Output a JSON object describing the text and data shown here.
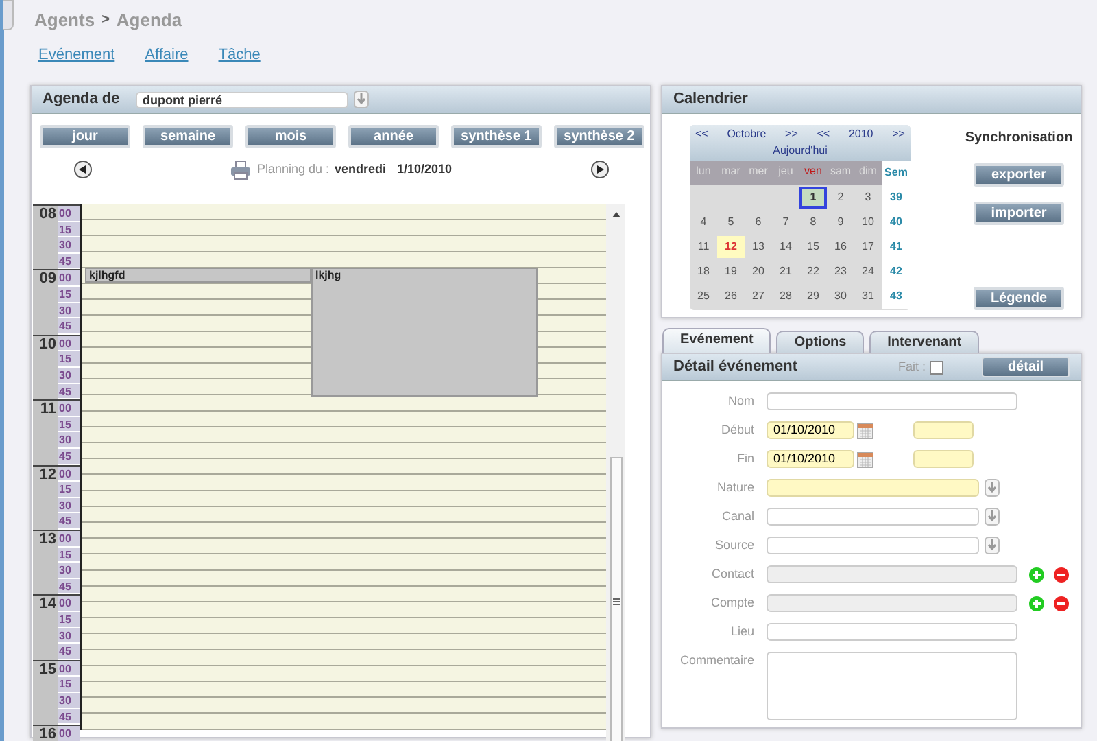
{
  "breadcrumb": [
    {
      "label": "Agents",
      "kind": "parent"
    },
    {
      "label": ">",
      "kind": "separator"
    },
    {
      "label": "Agenda",
      "kind": "current"
    }
  ],
  "links": [
    "Evénement",
    "Affaire",
    "Tâche"
  ],
  "agenda": {
    "title": "Agenda de",
    "owner": "dupont pierré",
    "views": [
      {
        "label": "jour"
      },
      {
        "label": "semaine"
      },
      {
        "label": "mois"
      },
      {
        "label": "année"
      },
      {
        "label": "synthèse 1"
      },
      {
        "label": "synthèse 2"
      }
    ],
    "planning_label": "Planning du :",
    "planning_day": "vendredi",
    "planning_date": "1/10/2010",
    "hours": [
      {
        "label": "08",
        "slots": [
          {
            "label": "00"
          },
          {
            "label": "15"
          },
          {
            "label": "30"
          },
          {
            "label": "45"
          }
        ]
      },
      {
        "label": "09",
        "slots": [
          {
            "label": "00",
            "cells": [
              {
                "kind": "event",
                "title": "kjlhgfd"
              },
              {
                "kind": "event",
                "title": "lkjhg"
              }
            ]
          },
          {
            "label": "15",
            "cells": [
              {
                "kind": "free"
              },
              {
                "kind": "continued"
              }
            ]
          },
          {
            "label": "30",
            "cells": [
              {
                "kind": "free"
              },
              {
                "kind": "continued"
              }
            ]
          },
          {
            "label": "45",
            "cells": [
              {
                "kind": "free"
              },
              {
                "kind": "continued"
              }
            ]
          }
        ]
      },
      {
        "label": "10",
        "slots": [
          {
            "label": "00",
            "cells": [
              {
                "kind": "free"
              },
              {
                "kind": "continued"
              }
            ]
          },
          {
            "label": "15",
            "cells": [
              {
                "kind": "free"
              },
              {
                "kind": "continued"
              }
            ]
          },
          {
            "label": "30",
            "cells": [
              {
                "kind": "free"
              },
              {
                "kind": "continued"
              }
            ]
          },
          {
            "label": "45",
            "cells": [
              {
                "kind": "free"
              },
              {
                "kind": "continued"
              }
            ]
          }
        ]
      },
      {
        "label": "11",
        "slots": [
          {
            "label": "00"
          },
          {
            "label": "15"
          },
          {
            "label": "30"
          },
          {
            "label": "45"
          }
        ]
      },
      {
        "label": "12",
        "slots": [
          {
            "label": "00"
          },
          {
            "label": "15"
          },
          {
            "label": "30"
          },
          {
            "label": "45"
          }
        ]
      },
      {
        "label": "13",
        "slots": [
          {
            "label": "00"
          },
          {
            "label": "15"
          },
          {
            "label": "30"
          },
          {
            "label": "45"
          }
        ]
      },
      {
        "label": "14",
        "slots": [
          {
            "label": "00"
          },
          {
            "label": "15"
          },
          {
            "label": "30"
          },
          {
            "label": "45"
          }
        ]
      },
      {
        "label": "15",
        "slots": [
          {
            "label": "00"
          },
          {
            "label": "15"
          },
          {
            "label": "30"
          },
          {
            "label": "45"
          }
        ]
      },
      {
        "label": "16",
        "slots": [
          {
            "label": "00"
          }
        ]
      }
    ]
  },
  "calendar": {
    "title": "Calendrier",
    "prev_month": "<<",
    "month": "Octobre",
    "next_month": ">>",
    "prev_year": "<<",
    "year": "2010",
    "next_year": ">>",
    "today_link": "Aujourd'hui",
    "weekdays": [
      {
        "label": "lun",
        "highlighted": false
      },
      {
        "label": "mar",
        "highlighted": false
      },
      {
        "label": "mer",
        "highlighted": false
      },
      {
        "label": "jeu",
        "highlighted": false
      },
      {
        "label": "ven",
        "highlighted": true
      },
      {
        "label": "sam",
        "highlighted": false
      },
      {
        "label": "dim",
        "highlighted": false
      }
    ],
    "week_header": "Sem",
    "weeks": [
      {
        "week": "39",
        "days": [
          {
            "kind": "blank"
          },
          {
            "kind": "blank"
          },
          {
            "kind": "blank"
          },
          {
            "kind": "blank"
          },
          {
            "kind": "day",
            "label": "1",
            "selected": true,
            "today": false
          },
          {
            "kind": "day",
            "label": "2",
            "selected": false,
            "today": false
          },
          {
            "kind": "day",
            "label": "3",
            "selected": false,
            "today": false
          }
        ]
      },
      {
        "week": "40",
        "days": [
          {
            "kind": "day",
            "label": "4",
            "selected": false,
            "today": false
          },
          {
            "kind": "day",
            "label": "5",
            "selected": false,
            "today": false
          },
          {
            "kind": "day",
            "label": "6",
            "selected": false,
            "today": false
          },
          {
            "kind": "day",
            "label": "7",
            "selected": false,
            "today": false
          },
          {
            "kind": "day",
            "label": "8",
            "selected": false,
            "today": false
          },
          {
            "kind": "day",
            "label": "9",
            "selected": false,
            "today": false
          },
          {
            "kind": "day",
            "label": "10",
            "selected": false,
            "today": false
          }
        ]
      },
      {
        "week": "41",
        "days": [
          {
            "kind": "day",
            "label": "11",
            "selected": false,
            "today": false
          },
          {
            "kind": "day",
            "label": "12",
            "selected": false,
            "today": true
          },
          {
            "kind": "day",
            "label": "13",
            "selected": false,
            "today": false
          },
          {
            "kind": "day",
            "label": "14",
            "selected": false,
            "today": false
          },
          {
            "kind": "day",
            "label": "15",
            "selected": false,
            "today": false
          },
          {
            "kind": "day",
            "label": "16",
            "selected": false,
            "today": false
          },
          {
            "kind": "day",
            "label": "17",
            "selected": false,
            "today": false
          }
        ]
      },
      {
        "week": "42",
        "days": [
          {
            "kind": "day",
            "label": "18",
            "selected": false,
            "today": false
          },
          {
            "kind": "day",
            "label": "19",
            "selected": false,
            "today": false
          },
          {
            "kind": "day",
            "label": "20",
            "selected": false,
            "today": false
          },
          {
            "kind": "day",
            "label": "21",
            "selected": false,
            "today": false
          },
          {
            "kind": "day",
            "label": "22",
            "selected": false,
            "today": false
          },
          {
            "kind": "day",
            "label": "23",
            "selected": false,
            "today": false
          },
          {
            "kind": "day",
            "label": "24",
            "selected": false,
            "today": false
          }
        ]
      },
      {
        "week": "43",
        "days": [
          {
            "kind": "day",
            "label": "25",
            "selected": false,
            "today": false
          },
          {
            "kind": "day",
            "label": "26",
            "selected": false,
            "today": false
          },
          {
            "kind": "day",
            "label": "27",
            "selected": false,
            "today": false
          },
          {
            "kind": "day",
            "label": "28",
            "selected": false,
            "today": false
          },
          {
            "kind": "day",
            "label": "29",
            "selected": false,
            "today": false
          },
          {
            "kind": "day",
            "label": "30",
            "selected": false,
            "today": false
          },
          {
            "kind": "day",
            "label": "31",
            "selected": false,
            "today": false
          }
        ]
      }
    ],
    "sync_title": "Synchronisation",
    "export_button": "exporter",
    "import_button": "importer",
    "legend_button": "Légende"
  },
  "tabs": [
    {
      "label": "Evénement",
      "selected": true
    },
    {
      "label": "Options",
      "selected": false
    },
    {
      "label": "Intervenant",
      "selected": false
    }
  ],
  "detail": {
    "title": "Détail événement",
    "done_label": "Fait :",
    "done": false,
    "detail_button": "détail",
    "fields": [
      {
        "label": "Nom",
        "kind": "text",
        "required": false
      },
      {
        "label": "Début",
        "kind": "datetime",
        "value": "01/10/2010",
        "required": true
      },
      {
        "label": "Fin",
        "kind": "datetime",
        "value": "01/10/2010",
        "required": true
      },
      {
        "label": "Nature",
        "kind": "select",
        "required": true
      },
      {
        "label": "Canal",
        "kind": "select",
        "required": false
      },
      {
        "label": "Source",
        "kind": "select",
        "required": false
      },
      {
        "label": "Contact",
        "kind": "lookup",
        "required": false
      },
      {
        "label": "Compte",
        "kind": "lookup",
        "required": false
      },
      {
        "label": "Lieu",
        "kind": "text",
        "required": false
      },
      {
        "label": "Commentaire",
        "kind": "textarea",
        "required": false
      }
    ]
  }
}
